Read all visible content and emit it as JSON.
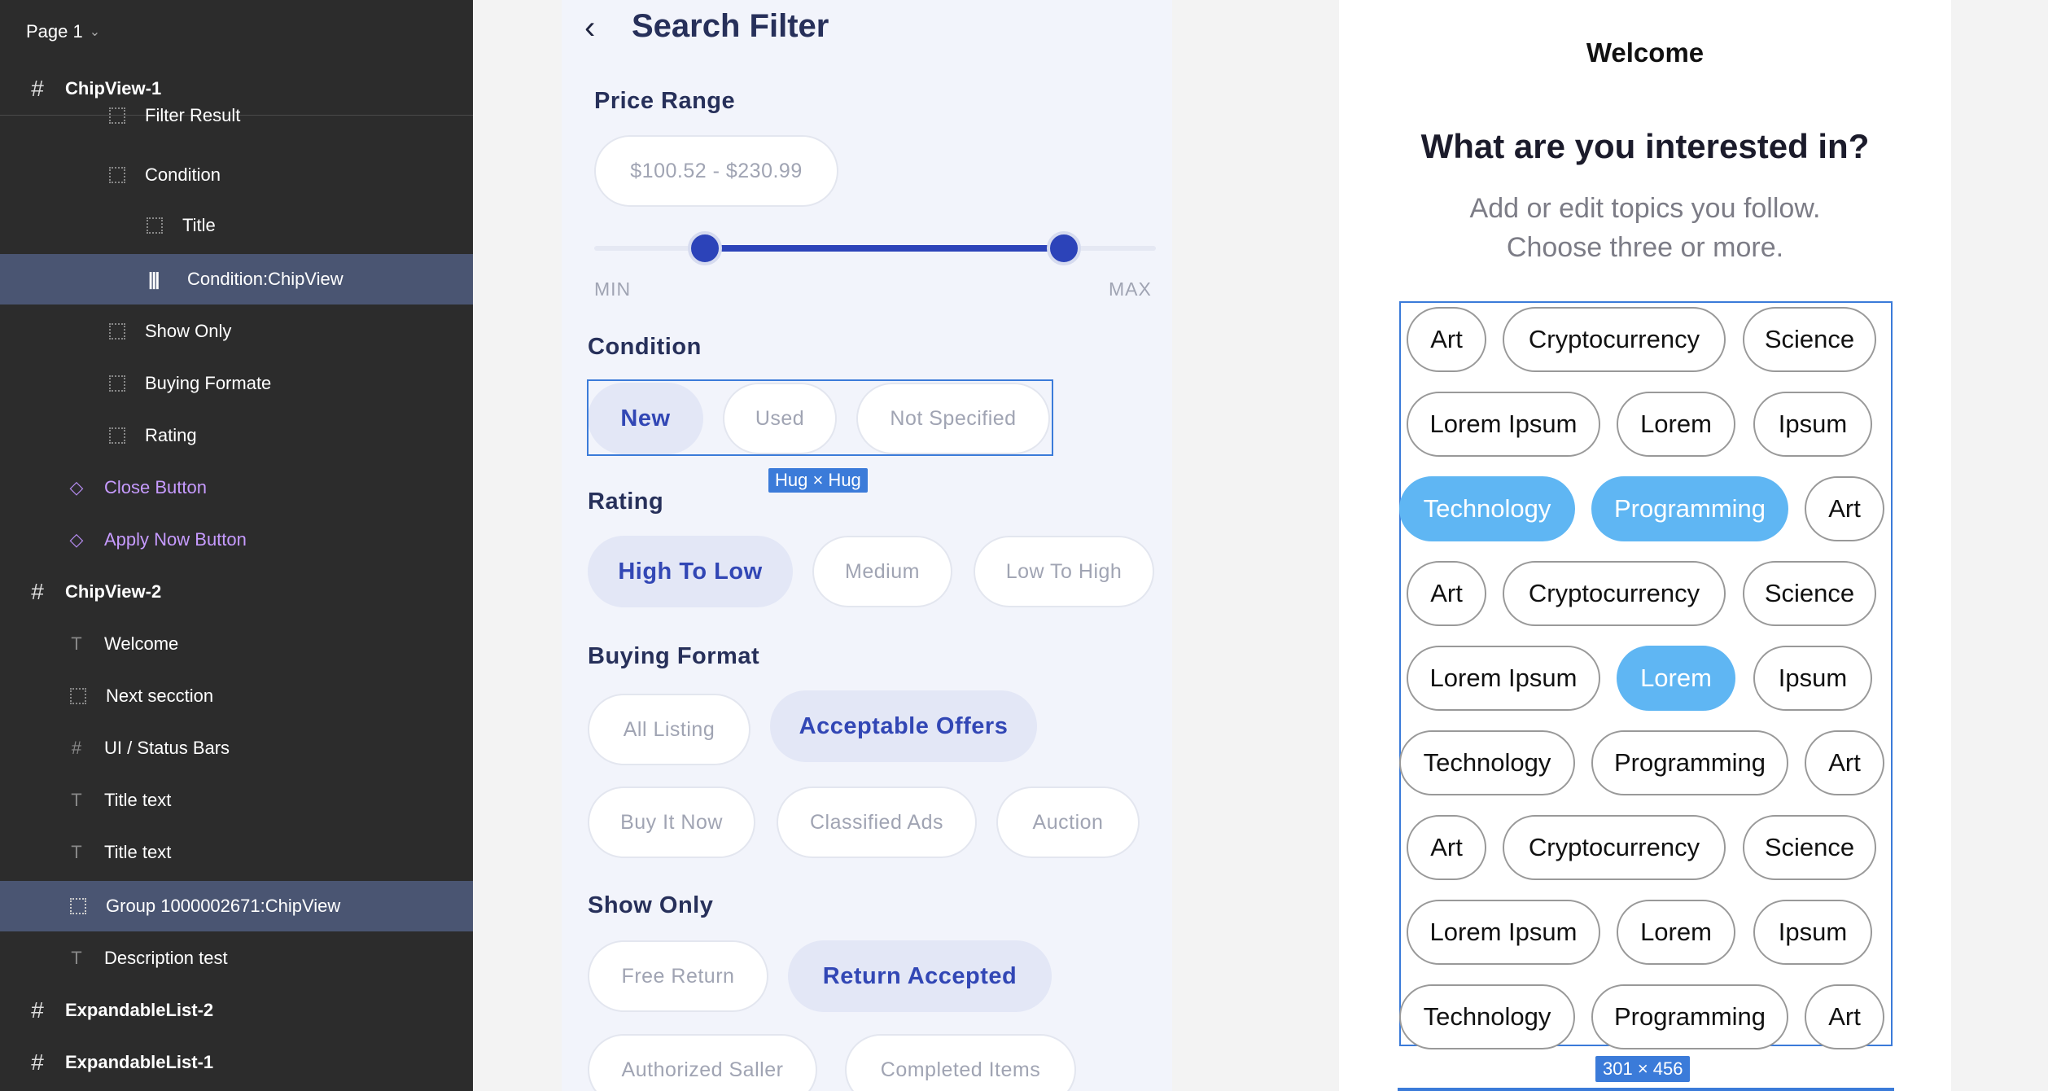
{
  "sidebar": {
    "page_label": "Page 1",
    "layers": [
      {
        "label": "ChipView-1",
        "type": "frame"
      },
      {
        "label": "Filter Result",
        "type": "group"
      },
      {
        "label": "Condition",
        "type": "group"
      },
      {
        "label": "Title",
        "type": "group"
      },
      {
        "label": "Condition:ChipView",
        "type": "chip",
        "selected": true
      },
      {
        "label": "Show Only",
        "type": "group"
      },
      {
        "label": "Buying Formate",
        "type": "group"
      },
      {
        "label": "Rating",
        "type": "group"
      },
      {
        "label": "Close Button",
        "type": "component"
      },
      {
        "label": "Apply Now Button",
        "type": "component"
      },
      {
        "label": "ChipView-2",
        "type": "frame"
      },
      {
        "label": "Welcome",
        "type": "text"
      },
      {
        "label": "Next secction",
        "type": "group"
      },
      {
        "label": "UI / Status Bars",
        "type": "frame-small"
      },
      {
        "label": "Title text",
        "type": "text"
      },
      {
        "label": "Title text",
        "type": "text"
      },
      {
        "label": "Group 1000002671:ChipView",
        "type": "group",
        "selected": true
      },
      {
        "label": "Description test",
        "type": "text"
      },
      {
        "label": "ExpandableList-2",
        "type": "frame"
      },
      {
        "label": "ExpandableList-1",
        "type": "frame"
      }
    ]
  },
  "filter": {
    "title": "Search Filter",
    "price_range": {
      "label": "Price Range",
      "value": "$100.52 - $230.99",
      "min_label": "MIN",
      "max_label": "MAX"
    },
    "condition": {
      "label": "Condition",
      "chips": [
        "New",
        "Used",
        "Not Specified"
      ],
      "selected": "New"
    },
    "hug_badge": "Hug × Hug",
    "rating": {
      "label": "Rating",
      "chips": [
        "High To Low",
        "Medium",
        "Low To High"
      ],
      "selected": "High To Low"
    },
    "buying_format": {
      "label": "Buying Format",
      "chips": [
        "All Listing",
        "Acceptable Offers",
        "Buy It Now",
        "Classified Ads",
        "Auction"
      ],
      "selected": "Acceptable Offers"
    },
    "show_only": {
      "label": "Show Only",
      "chips": [
        "Free Return",
        "Return Accepted",
        "Authorized Saller",
        "Completed Items"
      ],
      "selected": "Return Accepted"
    }
  },
  "welcome": {
    "title": "Welcome",
    "heading": "What are you interested in?",
    "desc_line1": "Add or edit topics you follow.",
    "desc_line2": "Choose three or more.",
    "size_badge": "301 × 456",
    "chips": [
      [
        "Art",
        "Cryptocurrency",
        "Science"
      ],
      [
        "Lorem Ipsum",
        "Lorem",
        "Ipsum"
      ],
      [
        "Technology",
        "Programming",
        "Art"
      ],
      [
        "Art",
        "Cryptocurrency",
        "Science"
      ],
      [
        "Lorem Ipsum",
        "Lorem",
        "Ipsum"
      ],
      [
        "Technology",
        "Programming",
        "Art"
      ],
      [
        "Art",
        "Cryptocurrency",
        "Science"
      ],
      [
        "Lorem Ipsum",
        "Lorem",
        "Ipsum"
      ],
      [
        "Technology",
        "Programming",
        "Art"
      ]
    ],
    "selected_chips": [
      "Technology",
      "Programming",
      "Lorem"
    ],
    "selected_rows": [
      2,
      4
    ]
  },
  "colors": {
    "sidebar_bg": "#2c2c2c",
    "selection_blue": "#3b7bd9",
    "chip_active_text": "#3247b5",
    "interest_selected": "#5fb6f3"
  }
}
